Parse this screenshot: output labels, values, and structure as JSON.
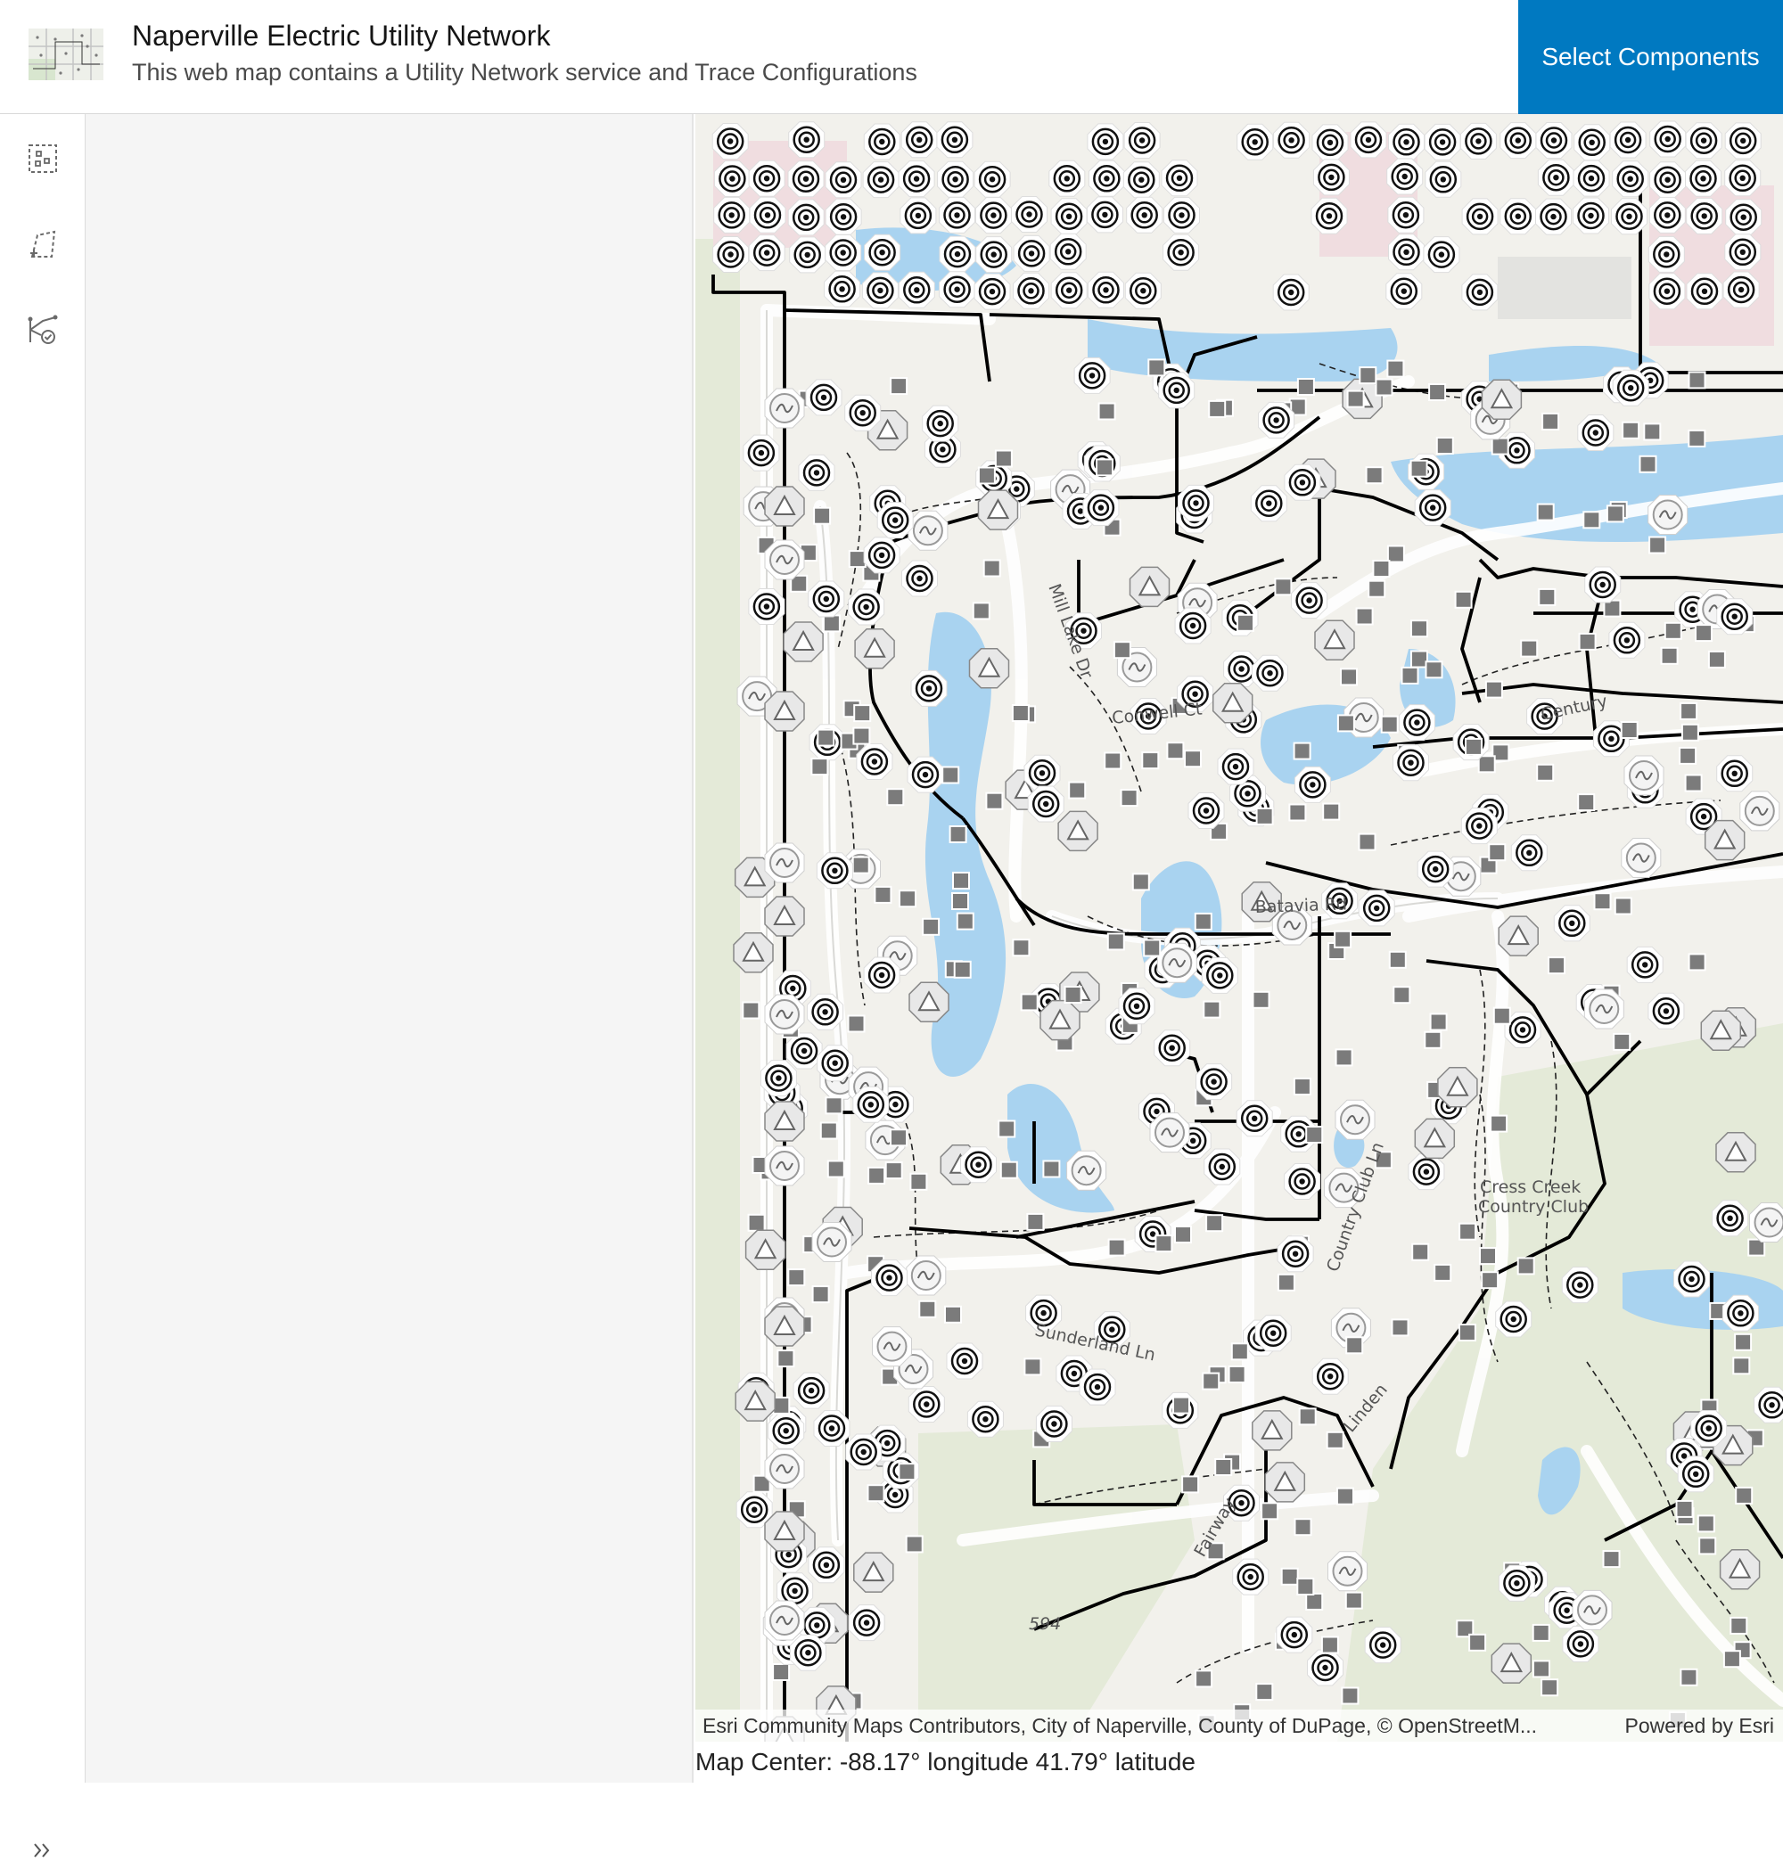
{
  "header": {
    "title": "Naperville Electric Utility Network",
    "subtitle": "This web map contains a Utility Network service and Trace Configurations",
    "select_button": "Select Components"
  },
  "toolbar": {
    "tools": [
      {
        "name": "select-by-rectangle-icon"
      },
      {
        "name": "select-by-polygon-icon"
      },
      {
        "name": "trace-icon"
      }
    ],
    "expand_icon": "chevrons-right-icon"
  },
  "map": {
    "labels": [
      "Cress Creek",
      "Country Club",
      "Batavia Rd",
      "Conwell Ct",
      "Century",
      "Country Club Ln",
      "Mill Lake Dr",
      "Sunderland Ln",
      "Linden",
      "Fairway",
      "594"
    ],
    "attribution": "Esri Community Maps Contributors, City of Naperville, County of DuPage, © OpenStreetM...",
    "powered_by": "Powered by Esri",
    "center_text": "Map Center: -88.17° longitude 41.79° latitude"
  },
  "colors": {
    "accent": "#0079c1",
    "water": "#a9d3f0",
    "park": "#e4ead8",
    "line": "#000000"
  }
}
